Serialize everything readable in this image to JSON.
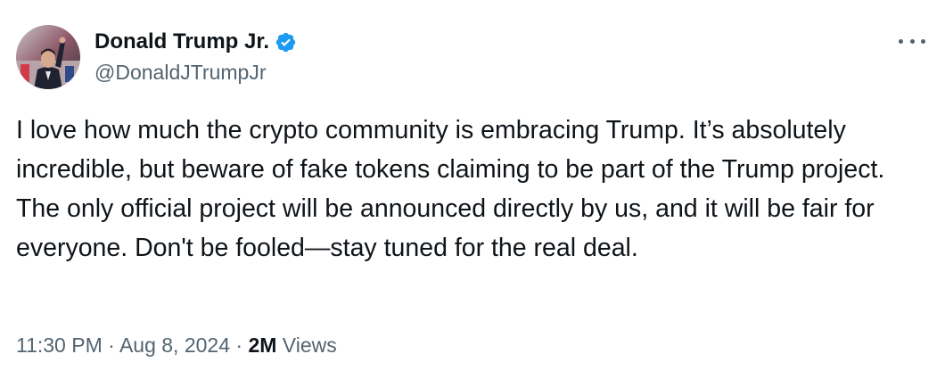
{
  "author": {
    "display_name": "Donald Trump Jr.",
    "handle": "@DonaldJTrumpJr",
    "verified": true
  },
  "tweet": {
    "text": "I love how much the crypto community is embracing Trump. It’s absolutely incredible, but beware of fake tokens claiming to be part of the Trump project. The only official project will be announced directly by us, and it will be fair for everyone. Don't be fooled—stay tuned for the real deal."
  },
  "meta": {
    "time": "11:30 PM",
    "separator": "·",
    "date": "Aug 8, 2024",
    "views_count": "2M",
    "views_label": "Views"
  },
  "icons": {
    "verified": "verified-badge-icon",
    "more": "more-options-icon"
  },
  "colors": {
    "verified_blue": "#1d9bf0",
    "text_primary": "#0f1419",
    "text_secondary": "#536471"
  }
}
